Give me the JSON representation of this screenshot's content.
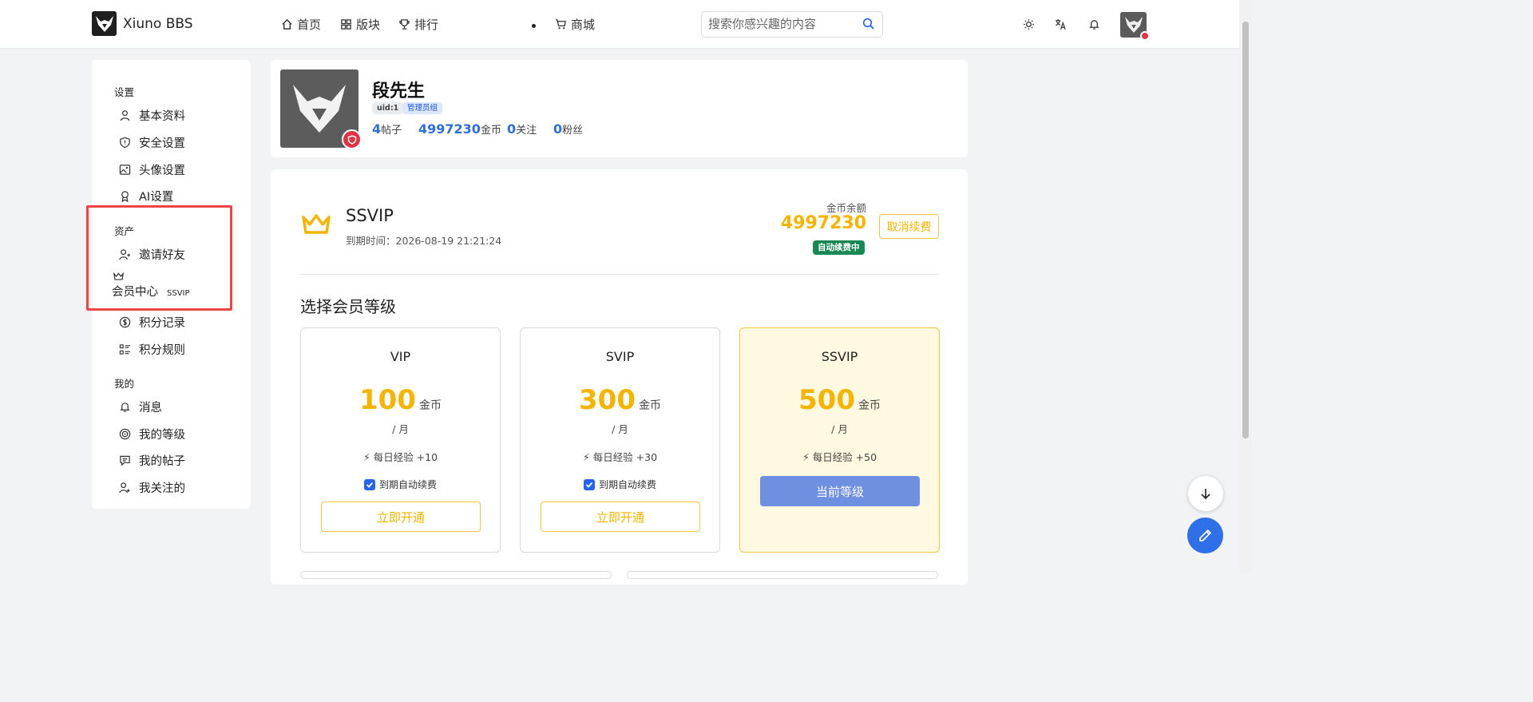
{
  "header": {
    "site_name": "Xiuno BBS",
    "nav": [
      {
        "label": "首页",
        "icon": "home-icon"
      },
      {
        "label": "版块",
        "icon": "grid-icon"
      },
      {
        "label": "排行",
        "icon": "trophy-icon"
      },
      {
        "label": "商城",
        "icon": "cart-icon"
      }
    ],
    "search_placeholder": "搜索你感兴趣的内容",
    "tools": [
      "sun-icon",
      "translate-icon",
      "bell-icon"
    ]
  },
  "sidebar": {
    "section_settings": "设置",
    "settings_items": [
      {
        "label": "基本资料",
        "icon": "user-icon"
      },
      {
        "label": "安全设置",
        "icon": "shield-icon"
      },
      {
        "label": "头像设置",
        "icon": "image-icon"
      },
      {
        "label": "AI设置",
        "icon": "award-icon"
      }
    ],
    "section_assets": "资产",
    "assets_items": [
      {
        "label": "邀请好友",
        "icon": "user-plus-icon"
      },
      {
        "label": "会员中心",
        "icon": "crown-icon",
        "tag": "SSVIP"
      },
      {
        "label": "积分记录",
        "icon": "coin-icon"
      },
      {
        "label": "积分规则",
        "icon": "list-icon"
      }
    ],
    "section_mine": "我的",
    "mine_items": [
      {
        "label": "消息",
        "icon": "bell-icon"
      },
      {
        "label": "我的等级",
        "icon": "level-icon"
      },
      {
        "label": "我的帖子",
        "icon": "message-icon"
      },
      {
        "label": "我关注的",
        "icon": "user-follow-icon"
      }
    ]
  },
  "profile": {
    "name": "段先生",
    "uid_tag": "uid:1",
    "group_tag": "管理员组",
    "stats": [
      {
        "value": "4",
        "label": "帖子"
      },
      {
        "value": "4997230",
        "label": "金币"
      },
      {
        "value": "0",
        "label": "关注"
      },
      {
        "value": "0",
        "label": "粉丝"
      }
    ]
  },
  "membership": {
    "level": "SSVIP",
    "expire_text": "到期时间：2026-08-19 21:21:24",
    "balance_label": "金币余额",
    "balance": "4997230",
    "auto_renew_badge": "自动续费中",
    "cancel_label": "取消续费",
    "choose_title": "选择会员等级",
    "plans": [
      {
        "name": "VIP",
        "price": "100",
        "unit": "金币",
        "per": "/ 月",
        "exp": "每日经验 +10",
        "renew": "到期自动续费",
        "button": "立即开通",
        "current": false
      },
      {
        "name": "SVIP",
        "price": "300",
        "unit": "金币",
        "per": "/ 月",
        "exp": "每日经验 +30",
        "renew": "到期自动续费",
        "button": "立即开通",
        "current": false
      },
      {
        "name": "SSVIP",
        "price": "500",
        "unit": "金币",
        "per": "/ 月",
        "exp": "每日经验 +50",
        "button": "当前等级",
        "current": true
      }
    ]
  },
  "colors": {
    "accent": "#f4b400",
    "primary": "#2f6fdb",
    "success": "#198754",
    "danger": "#dc3545",
    "highlight": "#ef4444"
  }
}
